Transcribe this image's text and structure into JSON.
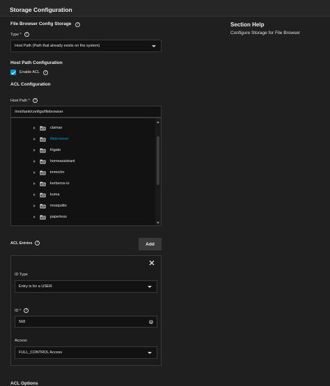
{
  "header": {
    "title": "Storage Configuration"
  },
  "help": {
    "title": "Section Help",
    "text": "Configure Storage for File Browser"
  },
  "config_storage": {
    "title": "File Browser Config Storage",
    "type_label": "Type",
    "required_mark": "*",
    "type_value": "Host Path (Path that already exists on the system)"
  },
  "host_path_config": {
    "title": "Host Path Configuration",
    "enable_acl_label": "Enable ACL",
    "enable_acl_checked": true
  },
  "acl_config": {
    "title": "ACL Configuration",
    "host_path_label": "Host Path",
    "host_path_value": "/mnt/tank/configs/filebrowser",
    "tree_items": [
      {
        "label": "clamav",
        "active": false
      },
      {
        "label": "filebrowser",
        "active": true
      },
      {
        "label": "frigate",
        "active": false
      },
      {
        "label": "homeassistant",
        "active": false
      },
      {
        "label": "immichn",
        "active": false
      },
      {
        "label": "kerberos-io",
        "active": false
      },
      {
        "label": "kuma",
        "active": false
      },
      {
        "label": "mosquitto",
        "active": false
      },
      {
        "label": "paperless",
        "active": false
      }
    ]
  },
  "acl_entries": {
    "title": "ACL Entries",
    "add_label": "Add",
    "id_type_label": "ID Type",
    "id_type_value": "Entry is for a USER",
    "id_label": "ID",
    "id_value": "568",
    "access_label": "Access",
    "access_value": "FULL_CONTROL Access"
  },
  "acl_options": {
    "title": "ACL Options"
  },
  "colors": {
    "accent": "#0095d5",
    "background": "#1f1f1f",
    "field": "#121212"
  }
}
